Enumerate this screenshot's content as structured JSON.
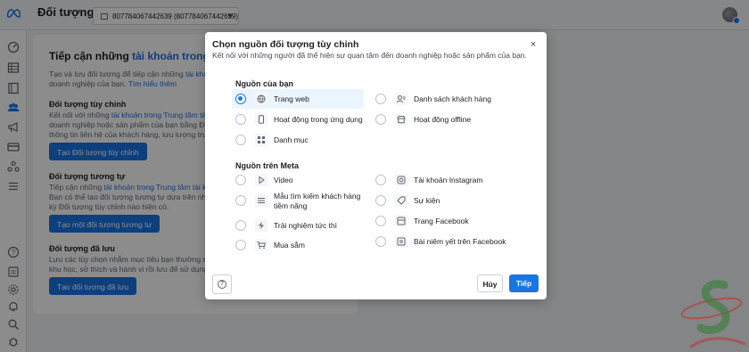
{
  "header": {
    "title": "Đối tượng",
    "account_selector": "807784067442639 (807784067442639)"
  },
  "background": {
    "heading_prefix": "Tiếp cận những ",
    "heading_link": "tài khoản trong Trung tâ",
    "intro_line1_prefix": "Tạo và lưu đối tượng để tiếp cận những ",
    "intro_line1_link": "tài khoản tr",
    "intro_line2_prefix": "doanh nghiệp của bạn. ",
    "intro_line2_link": "Tìm hiểu thêm",
    "custom": {
      "title": "Đối tượng tùy chỉnh",
      "line1_prefix": "Kết nối với những ",
      "line1_link": "tài khoản trong Trung tâm tài khoả",
      "line2": "doanh nghiệp hoặc sản phẩm của bạn bằng Đối tượng tùy",
      "line3": "thông tin liên hệ của khách hàng, lưu lượng truy cậ",
      "button": "Tạo Đối tượng tùy chỉnh"
    },
    "lookalike": {
      "title": "Đối tượng tương tự",
      "line1_prefix": "Tiếp cận những ",
      "line1_link": "tài khoản trong Trung tâm tài khoả",
      "line2": "Bạn có thể tạo đối tượng tương tự dựa trên những",
      "line3": "kỳ Đối tượng tùy chỉnh nào hiện có.",
      "button": "Tạo một đối tượng tương tự"
    },
    "saved": {
      "title": "Đối tượng đã lưu",
      "line1": "Lưu các tùy chọn nhắm mục tiêu bạn thường sử dụ",
      "line2": "khu học, sở thích và hành vi rồi lưu để sử dụng lại c",
      "button": "Tạo đối tượng đã lưu"
    }
  },
  "modal": {
    "title": "Chọn nguồn đối tượng tùy chỉnh",
    "subtitle": "Kết nối với những người đã thể hiện sự quan tâm đến doanh nghiệp hoặc sản phẩm của bạn.",
    "section_your_sources": "Nguồn của bạn",
    "section_meta_sources": "Nguồn trên Meta",
    "your_sources": [
      {
        "label": "Trang web",
        "icon": "globe-icon",
        "selected": true
      },
      {
        "label": "Danh sách khách hàng",
        "icon": "person-list-icon",
        "selected": false
      },
      {
        "label": "Hoạt động trong ứng dụng",
        "icon": "phone-icon",
        "selected": false
      },
      {
        "label": "Hoạt động offline",
        "icon": "store-icon",
        "selected": false
      },
      {
        "label": "Danh mục",
        "icon": "grid-icon",
        "selected": false
      }
    ],
    "meta_sources": [
      {
        "label": "Video",
        "icon": "play-icon"
      },
      {
        "label": "Tài khoản Instagram",
        "icon": "instagram-icon"
      },
      {
        "label_line1": "Mẫu tìm kiếm khách hàng",
        "label_line2": "tiềm năng",
        "icon": "form-icon"
      },
      {
        "label": "Sự kiện",
        "icon": "tag-icon"
      },
      {
        "label": "Trải nghiệm tức thì",
        "icon": "bolt-icon"
      },
      {
        "label": "Trang Facebook",
        "icon": "page-icon"
      },
      {
        "label": "Mua sắm",
        "icon": "cart-icon"
      },
      {
        "label": "Bài niêm yết trên Facebook",
        "icon": "listing-icon"
      }
    ],
    "help_label": "?",
    "cancel_label": "Hủy",
    "next_label": "Tiếp",
    "close_label": "×"
  },
  "colors": {
    "primary": "#1b74e4",
    "link": "#216fdb",
    "selected_bg": "#ebf5ff"
  }
}
